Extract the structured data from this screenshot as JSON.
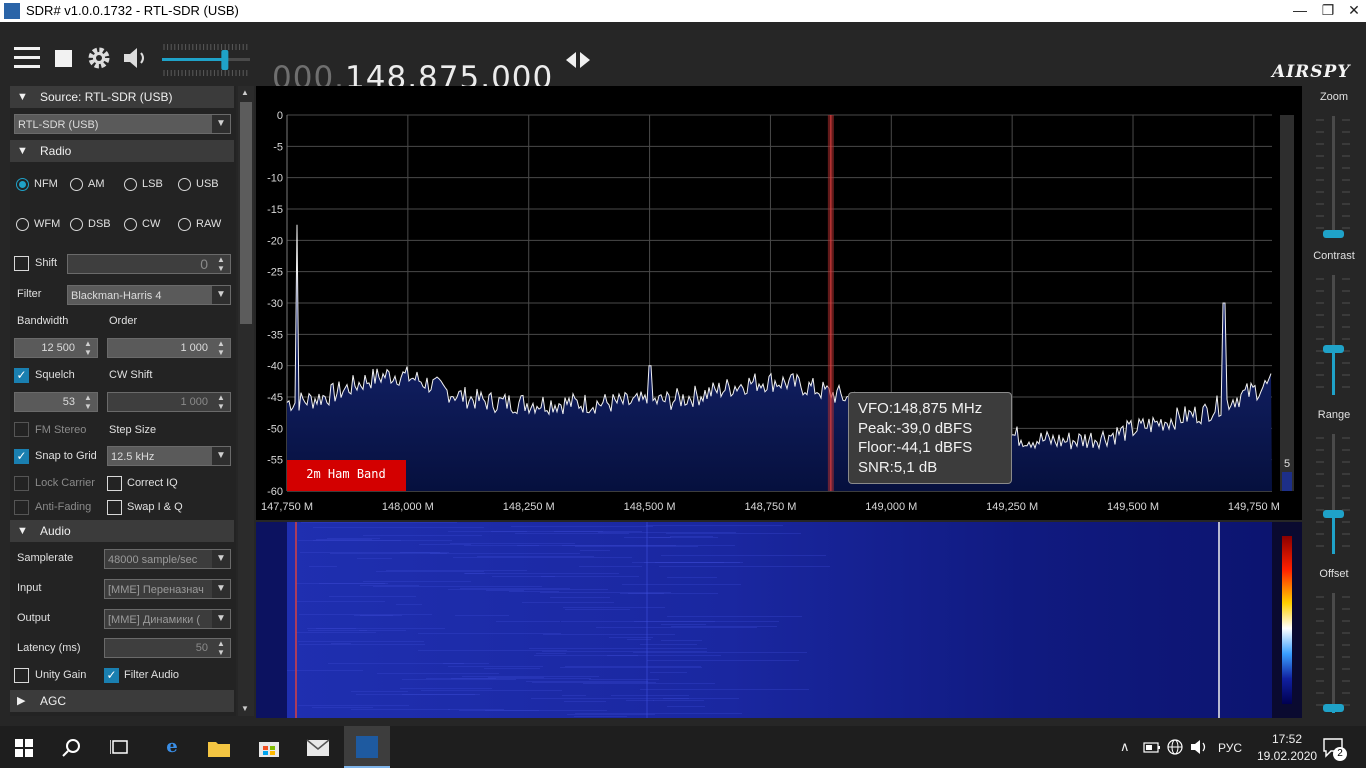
{
  "window": {
    "title": "SDR# v1.0.0.1732 - RTL-SDR (USB)",
    "minimize": "—",
    "restore": "❐",
    "close": "✕"
  },
  "toolbar": {
    "menu_icon": "menu-icon",
    "stop_icon": "stop-icon",
    "settings_icon": "gear-icon",
    "audio_icon": "speaker-icon",
    "volume_level": 0.72,
    "freq_dim": "000.",
    "freq_main": "148.875.000",
    "tune_arrows": "◂▸",
    "logo": "AIRSPY"
  },
  "source": {
    "header": "Source: RTL-SDR (USB)",
    "device": "RTL-SDR (USB)"
  },
  "radio": {
    "header": "Radio",
    "modes": [
      "NFM",
      "AM",
      "LSB",
      "USB",
      "WFM",
      "DSB",
      "CW",
      "RAW"
    ],
    "selected_mode": "NFM",
    "shift_label": "Shift",
    "shift_value": "0",
    "filter_label": "Filter",
    "filter_value": "Blackman-Harris 4",
    "bandwidth_label": "Bandwidth",
    "bandwidth_value": "12 500",
    "order_label": "Order",
    "order_value": "1 000",
    "squelch_label": "Squelch",
    "squelch_value": "53",
    "cwshift_label": "CW Shift",
    "cwshift_value": "1 000",
    "fmstereo_label": "FM Stereo",
    "stepsize_label": "Step Size",
    "snap_label": "Snap to Grid",
    "snap_value": "12.5 kHz",
    "lockcarrier_label": "Lock Carrier",
    "correctiq_label": "Correct IQ",
    "antifading_label": "Anti-Fading",
    "swapiq_label": "Swap I & Q"
  },
  "audio": {
    "header": "Audio",
    "samplerate_label": "Samplerate",
    "samplerate_value": "48000 sample/sec",
    "input_label": "Input",
    "input_value": "[MME] Переназнач",
    "output_label": "Output",
    "output_value": "[MME] Динамики (",
    "latency_label": "Latency (ms)",
    "latency_value": "50",
    "unitygain_label": "Unity Gain",
    "filteraudio_label": "Filter Audio"
  },
  "agc": {
    "header": "AGC"
  },
  "spectrum": {
    "y_ticks": [
      "0",
      "-5",
      "-10",
      "-15",
      "-20",
      "-25",
      "-30",
      "-35",
      "-40",
      "-45",
      "-50",
      "-55",
      "-60"
    ],
    "x_ticks": [
      "147,750 M",
      "148,000 M",
      "148,250 M",
      "148,500 M",
      "148,750 M",
      "149,000 M",
      "149,250 M",
      "149,500 M",
      "149,750 M"
    ],
    "band_label": "2m Ham Band",
    "right_value": "5",
    "tooltip": {
      "vfo": "VFO:148,875 MHz",
      "peak": "Peak:-39,0 dBFS",
      "floor": "Floor:-44,1 dBFS",
      "snr": "SNR:5,1 dB"
    }
  },
  "right_panel": {
    "zoom": "Zoom",
    "contrast": "Contrast",
    "range": "Range",
    "offset": "Offset"
  },
  "taskbar": {
    "lang": "РУС",
    "time": "17:52",
    "date": "19.02.2020",
    "notif_count": "2"
  }
}
